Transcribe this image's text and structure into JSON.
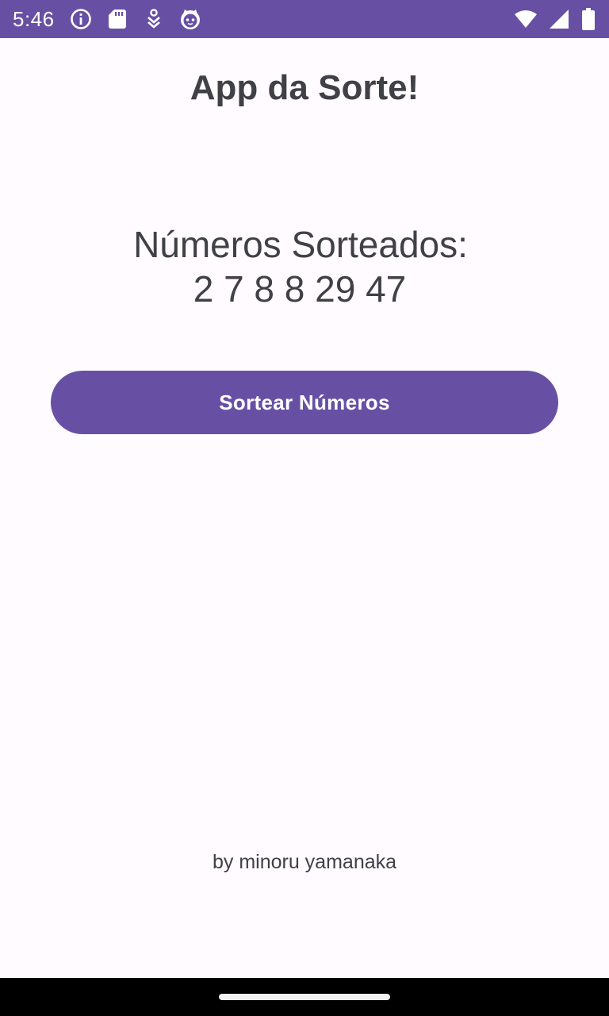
{
  "status_bar": {
    "time": "5:46",
    "background_color": "#6750a4",
    "left_icons": [
      "info-icon",
      "sd-card-icon",
      "download-icon",
      "cat-face-icon"
    ],
    "right_icons": [
      "wifi-icon",
      "signal-icon",
      "battery-icon"
    ]
  },
  "app": {
    "title": "App da Sorte!",
    "result_label": "Números Sorteados:",
    "result_numbers": "2 7 8 8 29 47",
    "button_label": "Sortear Números",
    "author": "by minoru yamanaka",
    "accent_color": "#6750a4",
    "text_color": "#404047",
    "background_color": "#fffbfe"
  },
  "navigation_bar": {
    "background_color": "#000000",
    "handle": "home-gesture-handle"
  }
}
